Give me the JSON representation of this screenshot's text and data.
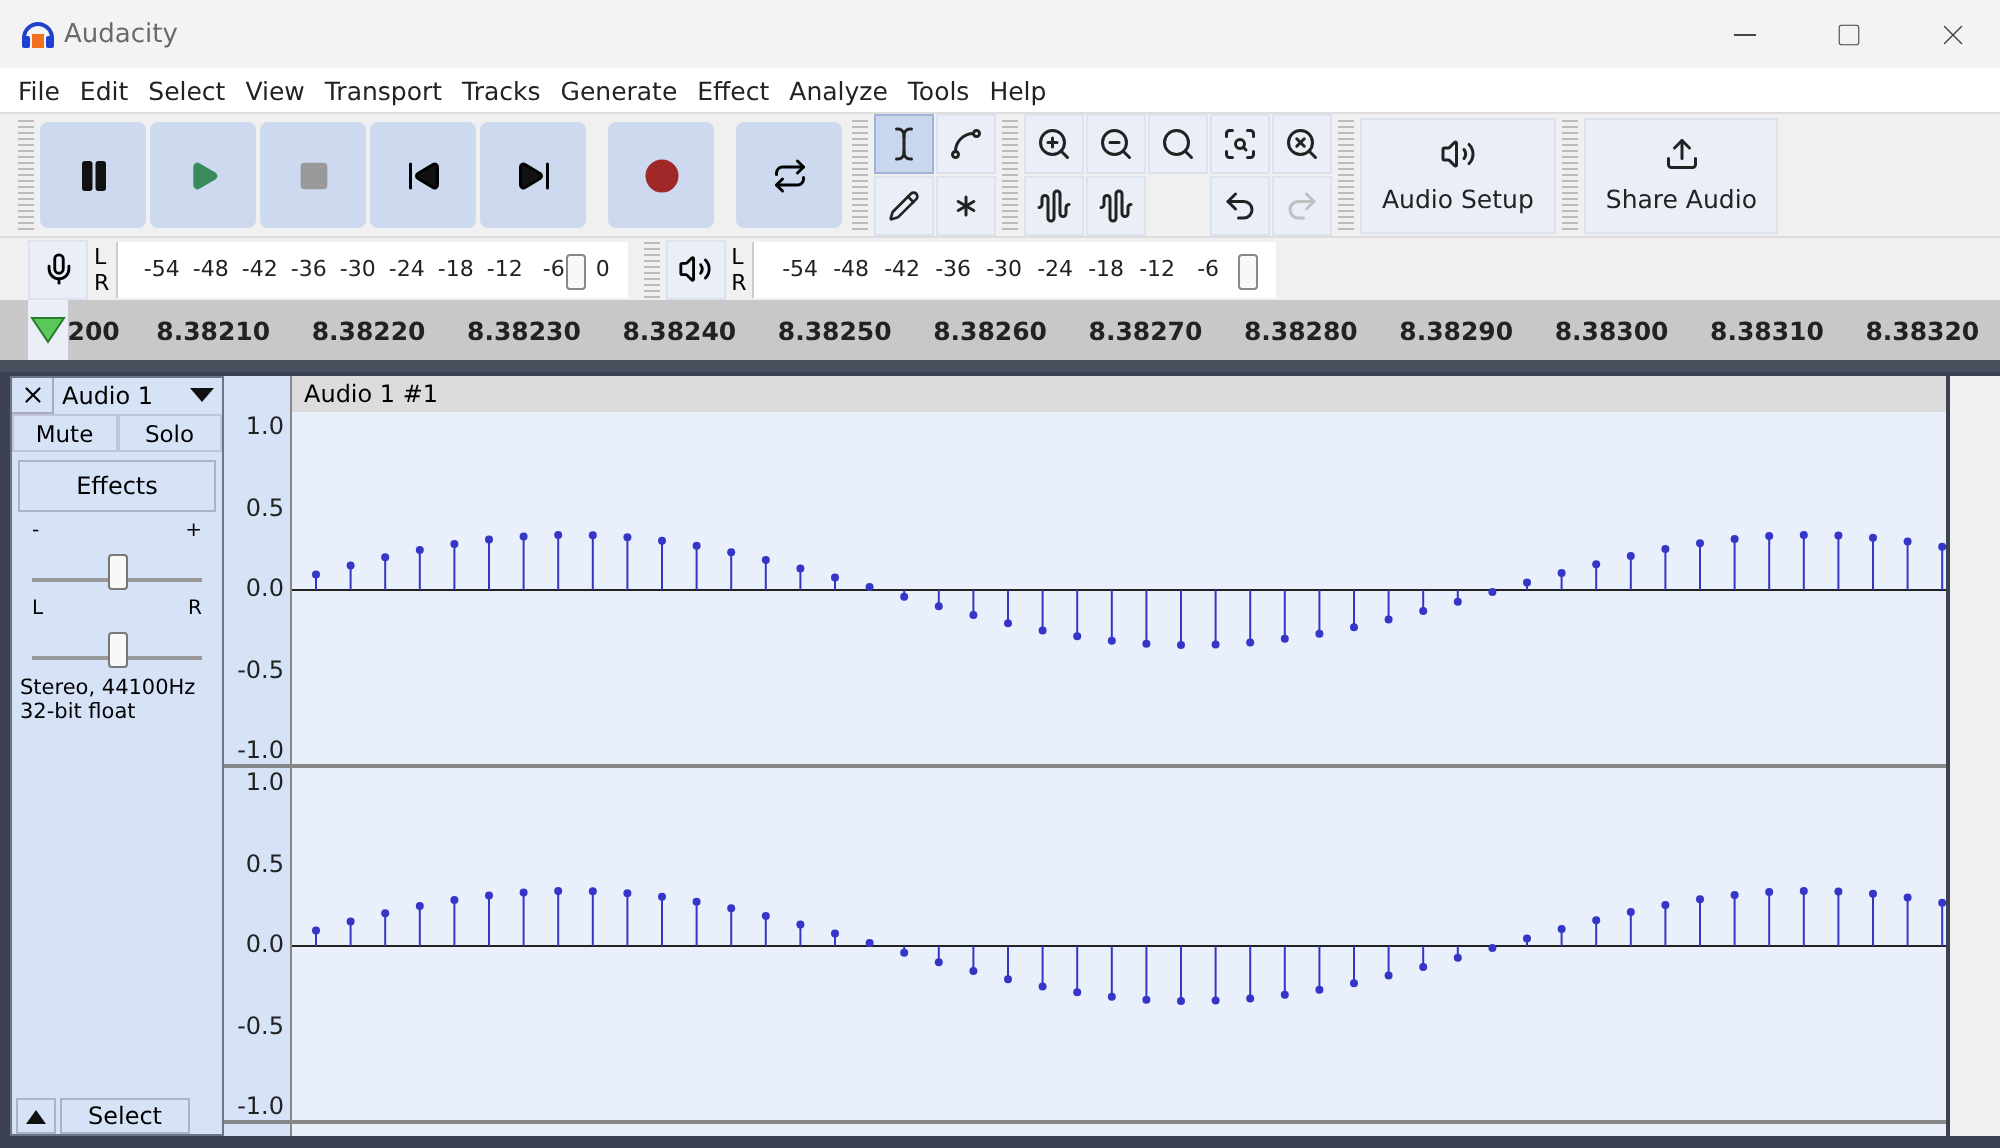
{
  "window": {
    "title": "Audacity"
  },
  "menu": [
    "File",
    "Edit",
    "Select",
    "View",
    "Transport",
    "Tracks",
    "Generate",
    "Effect",
    "Analyze",
    "Tools",
    "Help"
  ],
  "tools": [
    {
      "selected": true
    },
    {
      "selected": false
    },
    {
      "selected": false
    },
    {
      "selected": false
    }
  ],
  "history": [
    {
      "disabled": false
    },
    {
      "disabled": true
    }
  ],
  "audio_setup": {
    "label": "Audio Setup"
  },
  "share": {
    "label": "Share Audio"
  },
  "record_meter": {
    "channels": [
      "L",
      "R"
    ],
    "ticks": [
      "-54",
      "-48",
      "-42",
      "-36",
      "-30",
      "-24",
      "-18",
      "-12",
      "-6",
      "0"
    ],
    "level": 0.93
  },
  "playback_meter": {
    "channels": [
      "L",
      "R"
    ],
    "ticks": [
      "-54",
      "-48",
      "-42",
      "-36",
      "-30",
      "-24",
      "-18",
      "-12",
      "-6"
    ],
    "level": 0.98
  },
  "ruler": [
    "200",
    "8.38210",
    "8.38220",
    "8.38230",
    "8.38240",
    "8.38250",
    "8.38260",
    "8.38270",
    "8.38280",
    "8.38290",
    "8.38300",
    "8.38310",
    "8.38320"
  ],
  "track": {
    "name": "Audio 1",
    "mute": "Mute",
    "solo": "Solo",
    "effects": "Effects",
    "gain": {
      "min_label": "-",
      "max_label": "+",
      "level": 0.5
    },
    "pan": {
      "min_label": "L",
      "max_label": "R",
      "level": 0.5
    },
    "info": [
      "Stereo, 44100Hz",
      "32-bit float"
    ],
    "select": "Select",
    "clip_title": "Audio 1 #1",
    "channels": [
      {
        "axis": [
          "1.0",
          "0.5",
          "0.0",
          "-0.5",
          "-1.0"
        ]
      },
      {
        "axis": [
          "1.0",
          "0.5",
          "0.0",
          "-0.5",
          "-1.0"
        ]
      }
    ]
  }
}
